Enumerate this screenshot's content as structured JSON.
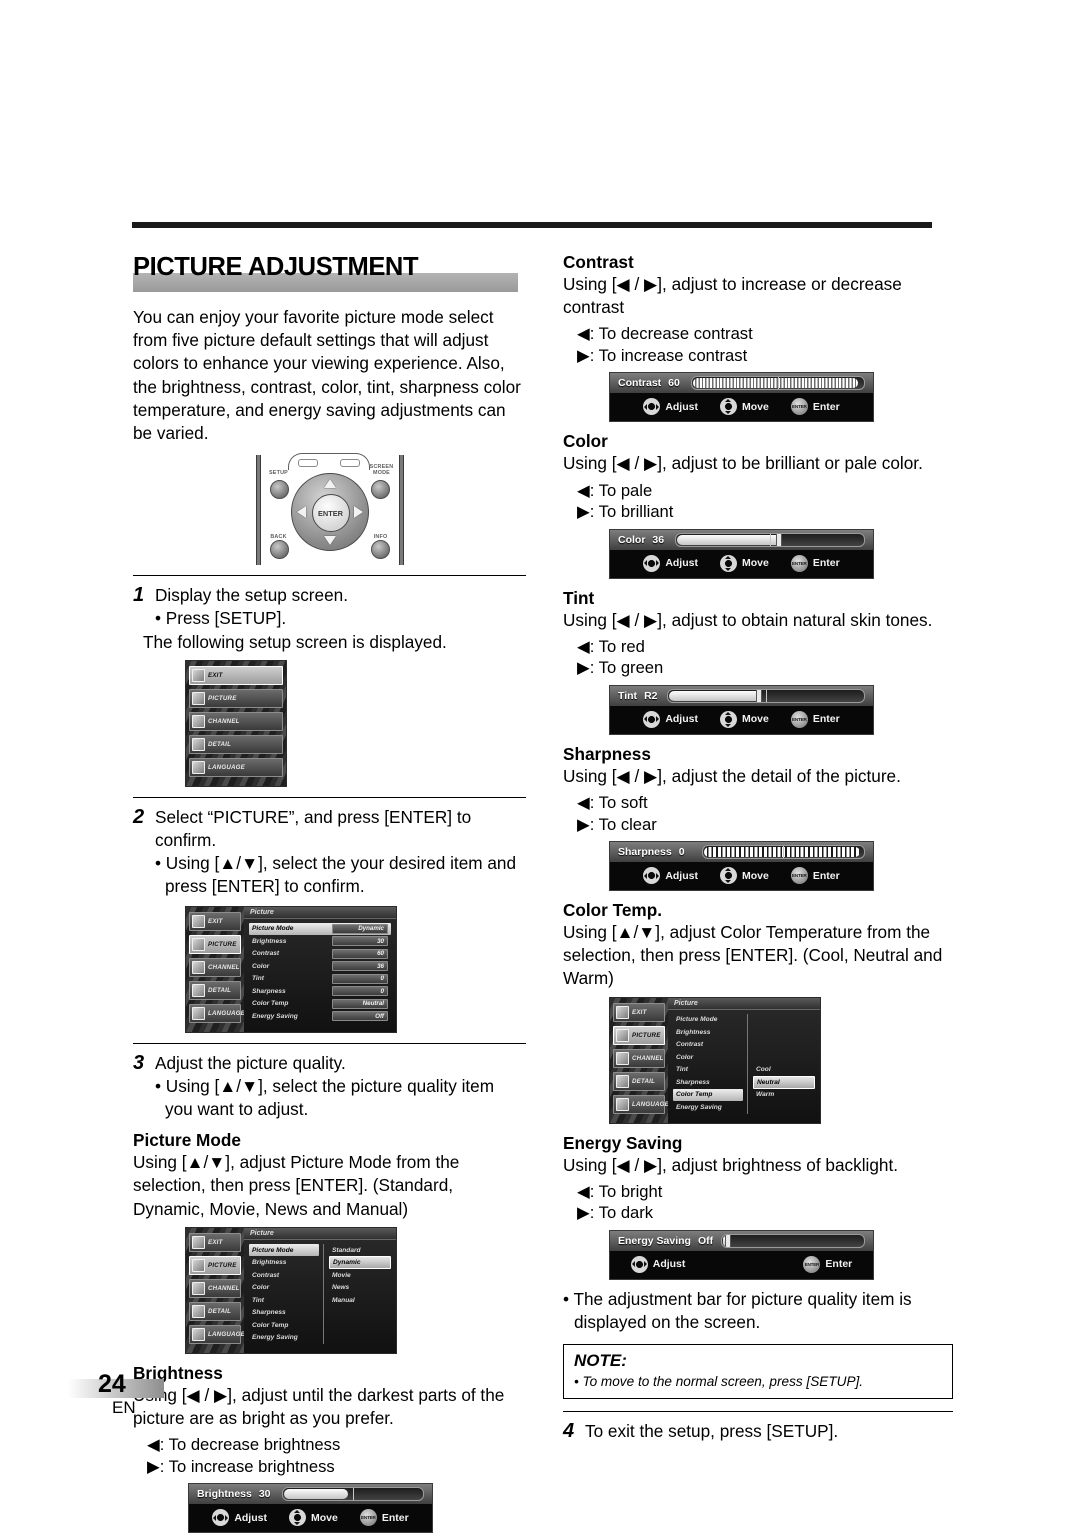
{
  "page": {
    "title": "PICTURE ADJUSTMENT",
    "folio_number": "24",
    "folio_lang": "EN"
  },
  "intro": {
    "paragraph": "You can enjoy your favorite picture mode select from five picture default settings that will adjust colors to enhance your viewing experience. Also, the brightness, contrast, color, tint, sharpness color temperature, and energy saving adjustments can be varied."
  },
  "remote": {
    "setup_label": "SETUP",
    "screen_mode_label": "SCREEN MODE",
    "back_label": "BACK",
    "info_label": "INFO",
    "enter_label": "ENTER"
  },
  "steps": {
    "step1": {
      "num": "1",
      "text": "Display the setup screen.",
      "bullet_a": "• Press [SETUP].",
      "bullet_b": "The following setup screen is displayed."
    },
    "step2": {
      "num": "2",
      "text": "Select “PICTURE”, and press [ENTER] to confirm.",
      "bullet_a": "• Using [▲/▼], select the your desired item and press [ENTER] to confirm."
    },
    "step3": {
      "num": "3",
      "text": "Adjust the picture quality.",
      "bullet_a": "• Using [▲/▼], select the picture quality item you want to adjust."
    },
    "step4": {
      "num": "4",
      "text": "To exit the setup, press [SETUP]."
    }
  },
  "setup_menu": {
    "items": [
      {
        "label": "EXIT",
        "selected": true
      },
      {
        "label": "PICTURE",
        "selected": false
      },
      {
        "label": "CHANNEL",
        "selected": false
      },
      {
        "label": "DETAIL",
        "selected": false
      },
      {
        "label": "LANGUAGE",
        "selected": false
      }
    ]
  },
  "picture_menu": {
    "header": "Picture",
    "side_items": [
      {
        "label": "EXIT",
        "selected": false
      },
      {
        "label": "PICTURE",
        "selected": true
      },
      {
        "label": "CHANNEL",
        "selected": false
      },
      {
        "label": "DETAIL",
        "selected": false
      },
      {
        "label": "LANGUAGE",
        "selected": false
      }
    ],
    "rows": [
      {
        "label": "Picture Mode",
        "value": "Dynamic",
        "highlighted": true
      },
      {
        "label": "Brightness",
        "value": "30",
        "highlighted": false
      },
      {
        "label": "Contrast",
        "value": "60",
        "highlighted": false
      },
      {
        "label": "Color",
        "value": "36",
        "highlighted": false
      },
      {
        "label": "Tint",
        "value": "0",
        "highlighted": false
      },
      {
        "label": "Sharpness",
        "value": "0",
        "highlighted": false
      },
      {
        "label": "Color Temp",
        "value": "Neutral",
        "highlighted": false
      },
      {
        "label": "Energy Saving",
        "value": "Off",
        "highlighted": false
      }
    ]
  },
  "picture_mode_menu": {
    "header": "Picture",
    "side_items": [
      {
        "label": "EXIT",
        "selected": false
      },
      {
        "label": "PICTURE",
        "selected": true
      },
      {
        "label": "CHANNEL",
        "selected": false
      },
      {
        "label": "DETAIL",
        "selected": false
      },
      {
        "label": "LANGUAGE",
        "selected": false
      }
    ],
    "rows": [
      {
        "label": "Picture Mode",
        "highlighted": true
      },
      {
        "label": "Brightness",
        "highlighted": false
      },
      {
        "label": "Contrast",
        "highlighted": false
      },
      {
        "label": "Color",
        "highlighted": false
      },
      {
        "label": "Tint",
        "highlighted": false
      },
      {
        "label": "Sharpness",
        "highlighted": false
      },
      {
        "label": "Color Temp",
        "highlighted": false
      },
      {
        "label": "Energy Saving",
        "highlighted": false
      }
    ],
    "options": [
      {
        "label": "Standard",
        "selected": false
      },
      {
        "label": "Dynamic",
        "selected": true
      },
      {
        "label": "Movie",
        "selected": false
      },
      {
        "label": "News",
        "selected": false
      },
      {
        "label": "Manual",
        "selected": false
      }
    ]
  },
  "color_temp_menu": {
    "header": "Picture",
    "side_items": [
      {
        "label": "EXIT",
        "selected": false
      },
      {
        "label": "PICTURE",
        "selected": true
      },
      {
        "label": "CHANNEL",
        "selected": false
      },
      {
        "label": "DETAIL",
        "selected": false
      },
      {
        "label": "LANGUAGE",
        "selected": false
      }
    ],
    "rows": [
      {
        "label": "Picture Mode",
        "highlighted": false
      },
      {
        "label": "Brightness",
        "highlighted": false
      },
      {
        "label": "Contrast",
        "highlighted": false
      },
      {
        "label": "Color",
        "highlighted": false
      },
      {
        "label": "Tint",
        "highlighted": false
      },
      {
        "label": "Sharpness",
        "highlighted": false
      },
      {
        "label": "Color Temp",
        "highlighted": true
      },
      {
        "label": "Energy Saving",
        "highlighted": false
      }
    ],
    "options": [
      {
        "label": "Cool",
        "selected": false
      },
      {
        "label": "Neutral",
        "selected": true
      },
      {
        "label": "Warm",
        "selected": false
      }
    ]
  },
  "sections": {
    "picture_mode": {
      "heading": "Picture Mode",
      "body": "Using [▲/▼], adjust Picture Mode from the selection, then press [ENTER]. (Standard, Dynamic, Movie, News and Manual)"
    },
    "brightness": {
      "heading": "Brightness",
      "body": "Using [◀ / ▶], adjust until the darkest parts of the picture are as bright as you prefer.",
      "arrow_left": "◀: To decrease brightness",
      "arrow_right": "▶: To increase brightness"
    },
    "contrast": {
      "heading": "Contrast",
      "body": "Using [◀ / ▶], adjust to increase or decrease contrast",
      "arrow_left": "◀: To decrease contrast",
      "arrow_right": "▶: To increase contrast"
    },
    "color": {
      "heading": "Color",
      "body": "Using [◀ / ▶], adjust to be brilliant or pale color.",
      "arrow_left": "◀: To pale",
      "arrow_right": "▶: To brilliant"
    },
    "tint": {
      "heading": "Tint",
      "body": "Using [◀ / ▶], adjust to obtain natural skin tones.",
      "arrow_left": "◀: To red",
      "arrow_right": "▶: To green"
    },
    "sharpness": {
      "heading": "Sharpness",
      "body": "Using [◀ / ▶], adjust the detail of the picture.",
      "arrow_left": "◀: To soft",
      "arrow_right": "▶: To clear"
    },
    "color_temp": {
      "heading": "Color Temp.",
      "body": "Using [▲/▼], adjust Color Temperature from the selection, then press [ENTER]. (Cool, Neutral and Warm)"
    },
    "energy_saving": {
      "heading": "Energy Saving",
      "body": "Using [◀ / ▶], adjust brightness of backlight.",
      "arrow_left": "◀: To bright",
      "arrow_right": "▶: To dark"
    }
  },
  "bars": {
    "common": {
      "adjust_label": "Adjust",
      "move_label": "Move",
      "enter_label": "Enter",
      "enter_glyph": "ENTER"
    },
    "brightness": {
      "label": "Brightness",
      "value": "30"
    },
    "contrast": {
      "label": "Contrast",
      "value": "60"
    },
    "color": {
      "label": "Color",
      "value": "36"
    },
    "tint": {
      "label": "Tint",
      "value": "R2"
    },
    "sharpness": {
      "label": "Sharpness",
      "value": "0"
    },
    "energy_saving": {
      "label": "Energy Saving",
      "value": "Off"
    }
  },
  "closing": {
    "bullet": "• The adjustment bar for picture quality item is displayed on the screen.",
    "note_title": "NOTE:",
    "note_body": "• To move to the normal screen, press [SETUP]."
  }
}
